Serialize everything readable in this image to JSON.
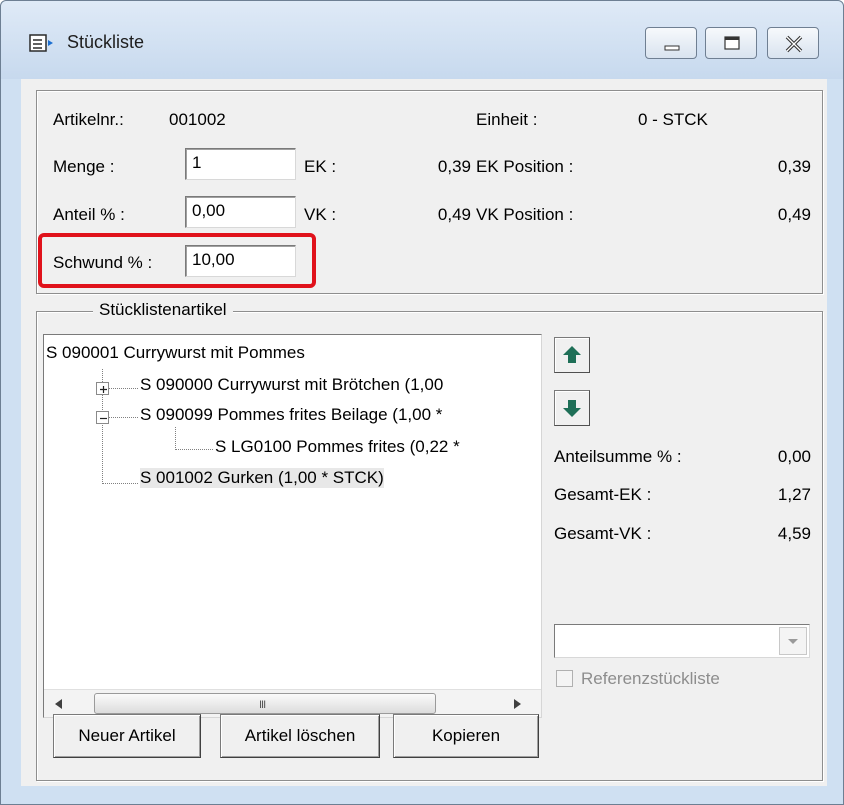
{
  "window": {
    "title": "Stückliste",
    "buttons": [
      "minimize",
      "maximize",
      "close"
    ]
  },
  "header": {
    "artikelnr_label": "Artikelnr.:",
    "artikelnr_value": "001002",
    "einheit_label": "Einheit :",
    "einheit_value": "0 - STCK",
    "menge_label": "Menge :",
    "menge_value": "1",
    "anteil_label": "Anteil % :",
    "anteil_value": "0,00",
    "schwund_label": "Schwund % :",
    "schwund_value": "10,00",
    "ek_label": "EK :",
    "ek_value": "0,39",
    "vk_label": "VK :",
    "vk_value": "0,49",
    "ek_position_label": "EK Position :",
    "ek_position_value": "0,39",
    "vk_position_label": "VK Position :",
    "vk_position_value": "0,49"
  },
  "tree": {
    "group_title": "Stücklistenartikel",
    "items": [
      {
        "label": "S 090001 Currywurst mit Pommes",
        "level": 0
      },
      {
        "label": "S 090000 Currywurst mit Brötchen  (1,00",
        "level": 1,
        "expander": "plus"
      },
      {
        "label": "S 090099 Pommes frites Beilage  (1,00 *",
        "level": 1,
        "expander": "minus"
      },
      {
        "label": "S LG0100 Pommes frites  (0,22 *",
        "level": 2
      },
      {
        "label": "S 001002 Gurken  (1,00 * STCK)",
        "level": 1,
        "selected": true
      }
    ],
    "scroll_grip": "III"
  },
  "summary": {
    "anteilsumme_label": "Anteilsumme % :",
    "anteilsumme_value": "0,00",
    "gesamt_ek_label": "Gesamt-EK :",
    "gesamt_ek_value": "1,27",
    "gesamt_vk_label": "Gesamt-VK :",
    "gesamt_vk_value": "4,59",
    "combo_value": "",
    "referenz_label": "Referenzstückliste",
    "referenz_checked": false
  },
  "buttons": {
    "neuer_artikel": "Neuer Artikel",
    "artikel_loeschen": "Artikel löschen",
    "kopieren": "Kopieren"
  },
  "colors": {
    "highlight": "#e0121b",
    "arrow_green": "#1e6f57"
  },
  "icons": [
    "app-icon",
    "minimize-icon",
    "maximize-icon",
    "close-icon",
    "arrow-up-icon",
    "arrow-down-icon",
    "chevron-down-icon",
    "scroll-left-icon",
    "scroll-right-icon"
  ]
}
